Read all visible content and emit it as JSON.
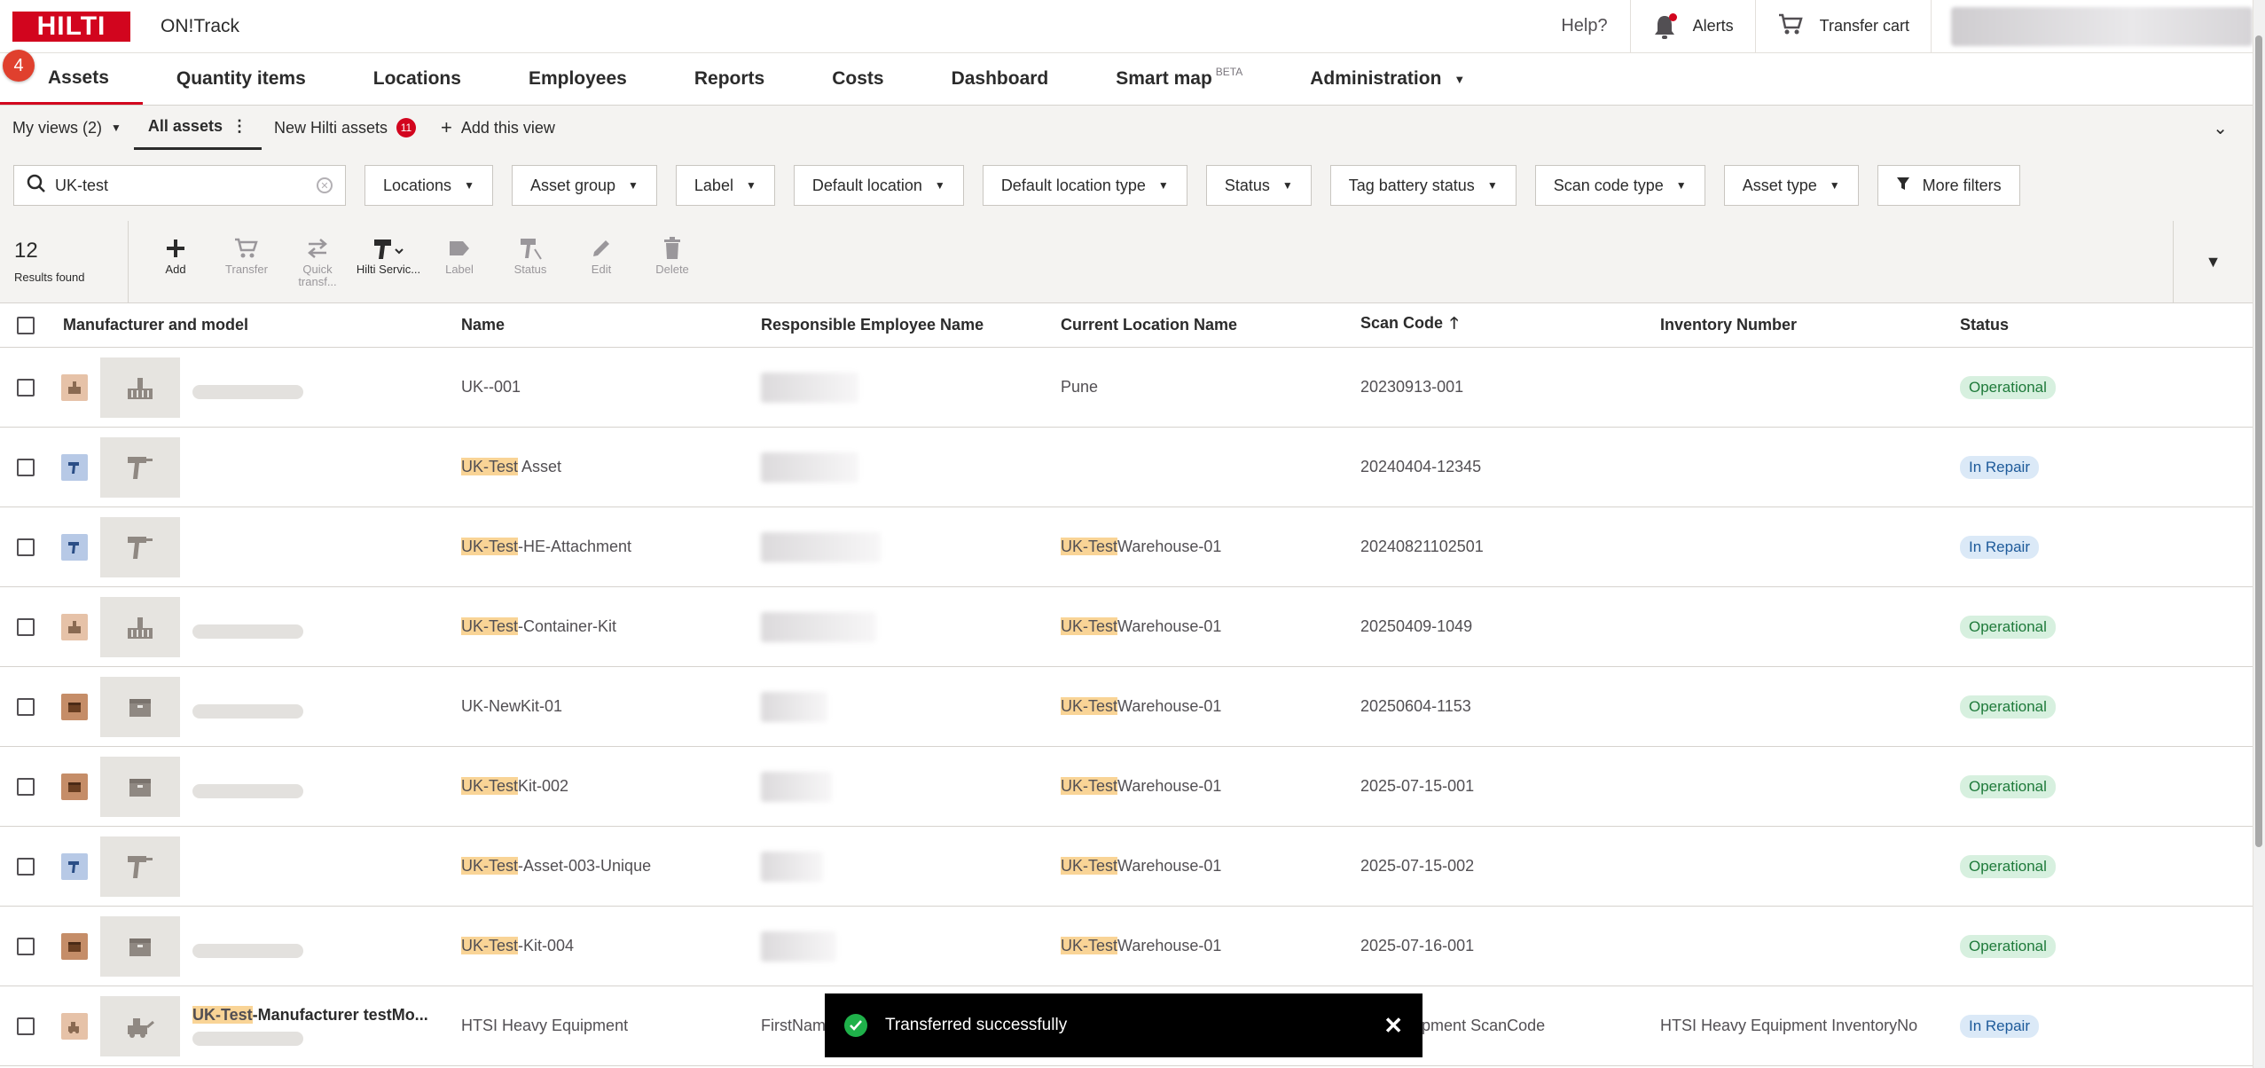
{
  "brand": {
    "logo_text": "HILTI",
    "app_name": "ON!Track",
    "accent": "#d2051e"
  },
  "topbar": {
    "help": "Help?",
    "alerts": "Alerts",
    "transfer_cart": "Transfer cart"
  },
  "step_badge": "4",
  "nav": {
    "tabs": [
      {
        "label": "Assets",
        "active": true
      },
      {
        "label": "Quantity items"
      },
      {
        "label": "Locations"
      },
      {
        "label": "Employees"
      },
      {
        "label": "Reports"
      },
      {
        "label": "Costs"
      },
      {
        "label": "Dashboard"
      },
      {
        "label": "Smart map",
        "beta": "BETA"
      },
      {
        "label": "Administration",
        "dropdown": true
      }
    ]
  },
  "views": {
    "my_views": "My views (2)",
    "all_assets": "All assets",
    "new_hilti": "New Hilti assets",
    "new_hilti_count": "11",
    "add_view": "Add this view"
  },
  "filters": {
    "search_value": "UK-test",
    "buttons": [
      "Locations",
      "Asset group",
      "Label",
      "Default location",
      "Default location type",
      "Status",
      "Tag battery status",
      "Scan code type",
      "Asset type"
    ],
    "more": "More filters"
  },
  "results": {
    "count": "12",
    "label": "Results found"
  },
  "actions": [
    {
      "label": "Add",
      "icon": "plus-icon",
      "enabled": true
    },
    {
      "label": "Transfer",
      "icon": "transfer-cart-icon",
      "enabled": false
    },
    {
      "label": "Quick transf...",
      "icon": "quick-transfer-icon",
      "enabled": false
    },
    {
      "label": "Hilti Servic...",
      "icon": "hilti-service-icon",
      "enabled": true
    },
    {
      "label": "Label",
      "icon": "label-icon",
      "enabled": false
    },
    {
      "label": "Status",
      "icon": "status-icon",
      "enabled": false
    },
    {
      "label": "Edit",
      "icon": "edit-icon",
      "enabled": false
    },
    {
      "label": "Delete",
      "icon": "delete-icon",
      "enabled": false
    }
  ],
  "table": {
    "headers": {
      "mfr": "Manufacturer and model",
      "name": "Name",
      "employee": "Responsible Employee Name",
      "location": "Current Location Name",
      "scan": "Scan Code",
      "inventory": "Inventory Number",
      "status": "Status"
    },
    "rows": [
      {
        "type": "container",
        "name_hl": "",
        "name_rest": "UK--001",
        "loc_hl": "",
        "loc_rest": "Pune",
        "scan": "20230913-001",
        "inventory": "",
        "status": "Operational"
      },
      {
        "type": "tool",
        "name_hl": "UK-Test",
        "name_rest": " Asset",
        "loc_hl": "",
        "loc_rest": "",
        "scan": "20240404-12345",
        "inventory": "",
        "status": "In Repair"
      },
      {
        "type": "tool",
        "name_hl": "UK-Test",
        "name_rest": "-HE-Attachment",
        "loc_hl": "UK-Test",
        "loc_rest": "Warehouse-01",
        "scan": "20240821102501",
        "inventory": "",
        "status": "In Repair"
      },
      {
        "type": "container",
        "name_hl": "UK-Test",
        "name_rest": "-Container-Kit",
        "loc_hl": "UK-Test",
        "loc_rest": "Warehouse-01",
        "scan": "20250409-1049",
        "inventory": "",
        "status": "Operational"
      },
      {
        "type": "kit",
        "name_hl": "",
        "name_rest": "UK-NewKit-01",
        "loc_hl": "UK-Test",
        "loc_rest": "Warehouse-01",
        "scan": "20250604-1153",
        "inventory": "",
        "status": "Operational"
      },
      {
        "type": "kit",
        "name_hl": "UK-Test",
        "name_rest": "Kit-002",
        "loc_hl": "UK-Test",
        "loc_rest": "Warehouse-01",
        "scan": "2025-07-15-001",
        "inventory": "",
        "status": "Operational"
      },
      {
        "type": "tool",
        "name_hl": "UK-Test",
        "name_rest": "-Asset-003-Unique",
        "loc_hl": "UK-Test",
        "loc_rest": "Warehouse-01",
        "scan": "2025-07-15-002",
        "inventory": "",
        "status": "Operational"
      },
      {
        "type": "kit",
        "name_hl": "UK-Test",
        "name_rest": "-Kit-004",
        "loc_hl": "UK-Test",
        "loc_rest": "Warehouse-01",
        "scan": "2025-07-16-001",
        "inventory": "",
        "status": "Operational"
      },
      {
        "type": "heavy",
        "mfr_hl": "UK-Test",
        "mfr_rest": "-Manufacturer testMo...",
        "name_hl": "",
        "name_rest": "HTSI Heavy Equipment",
        "employee": "FirstNam",
        "loc_hl": "",
        "loc_rest": "",
        "scan": "avy Equipment ScanCode",
        "inventory": "HTSI Heavy Equipment InventoryNo",
        "status": "In Repair"
      }
    ]
  },
  "toast": {
    "message": "Transferred successfully"
  }
}
